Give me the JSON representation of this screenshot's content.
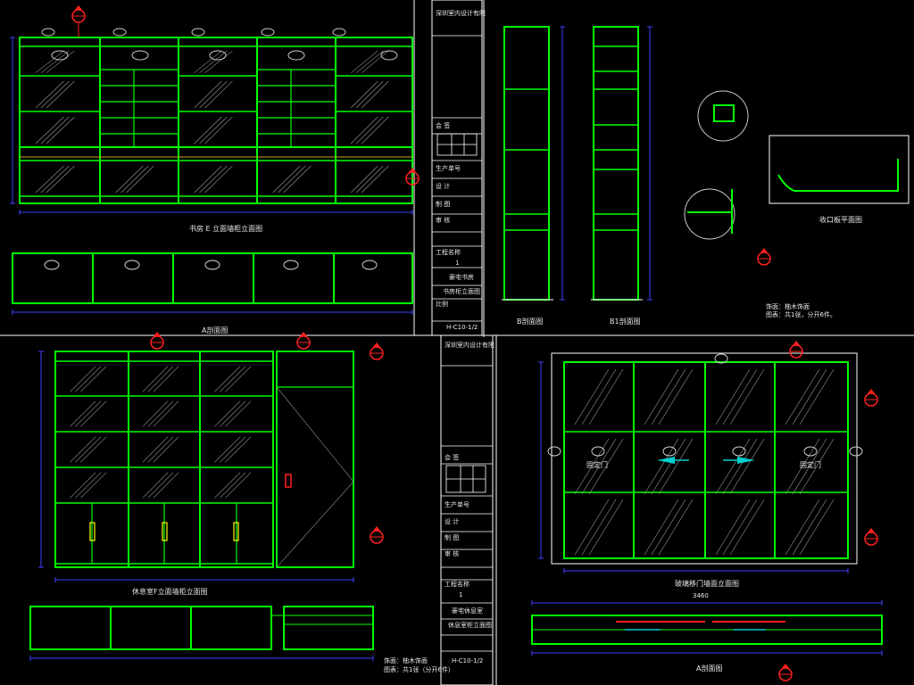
{
  "colors": {
    "frame": "#ffffff",
    "line": "#00ff00",
    "line2": "#3fbf3f",
    "dim": "#4040ff",
    "red": "#ff2020",
    "cyan": "#00cccc",
    "yellow": "#ffff00",
    "text": "#e8e8e8"
  },
  "titles": {
    "tl_elev": "书房 E 立面墙柜立面图",
    "tl_plan": "A剖面图",
    "tm_sec1": "B剖面图",
    "tm_sec2": "B1剖面图",
    "tr_detail": "收口板平面图",
    "bl_elev": "休息室F立面墙柜立面图",
    "br_elev": "玻璃移门墙面立面图",
    "br_plan": "A剖面图"
  },
  "notes": {
    "tr_note1": "饰面：柚木饰面",
    "tr_note2": "图表：共1张，分开6件。",
    "bl_note1": "饰面：柚木饰面",
    "bl_note2": "图表：共1张（分开6件）"
  },
  "door_labels": {
    "left": "固定门",
    "right": "固定门"
  },
  "dims": {
    "overall": "3460",
    "br_overall": "3460"
  },
  "title_block": {
    "designer": "深圳室内设计有限",
    "field_table": "会 签",
    "client": "生产单号",
    "design": "设 计",
    "draw": "制 图",
    "check": "审 核",
    "project": "工程名称",
    "code": "1",
    "name1": "豪宅书房",
    "name2": "书房柜立面图",
    "scale": "比例",
    "sheet": "H-C10-1/2"
  },
  "title_block2": {
    "designer": "深圳室内设计有限",
    "field_table": "会 签",
    "client": "生产单号",
    "design": "设 计",
    "draw": "制 图",
    "check": "审 核",
    "project": "工程名称",
    "code": "1",
    "name1": "豪宅休息室",
    "name2": "休息室柜立面图",
    "sheet": "H-C10-1/2"
  }
}
